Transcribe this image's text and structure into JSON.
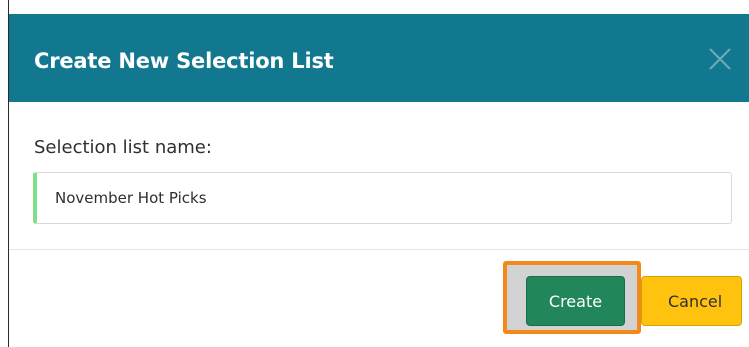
{
  "dialog": {
    "title": "Create New Selection List",
    "close_icon": "close-icon"
  },
  "form": {
    "label": "Selection list name:",
    "name_value": "November Hot Picks"
  },
  "footer": {
    "create_label": "Create",
    "cancel_label": "Cancel"
  },
  "colors": {
    "header": "#12788f",
    "create_button": "#21875a",
    "cancel_button": "#ffc30f",
    "highlight": "#f28a1b",
    "input_accent": "#7fe08c"
  }
}
